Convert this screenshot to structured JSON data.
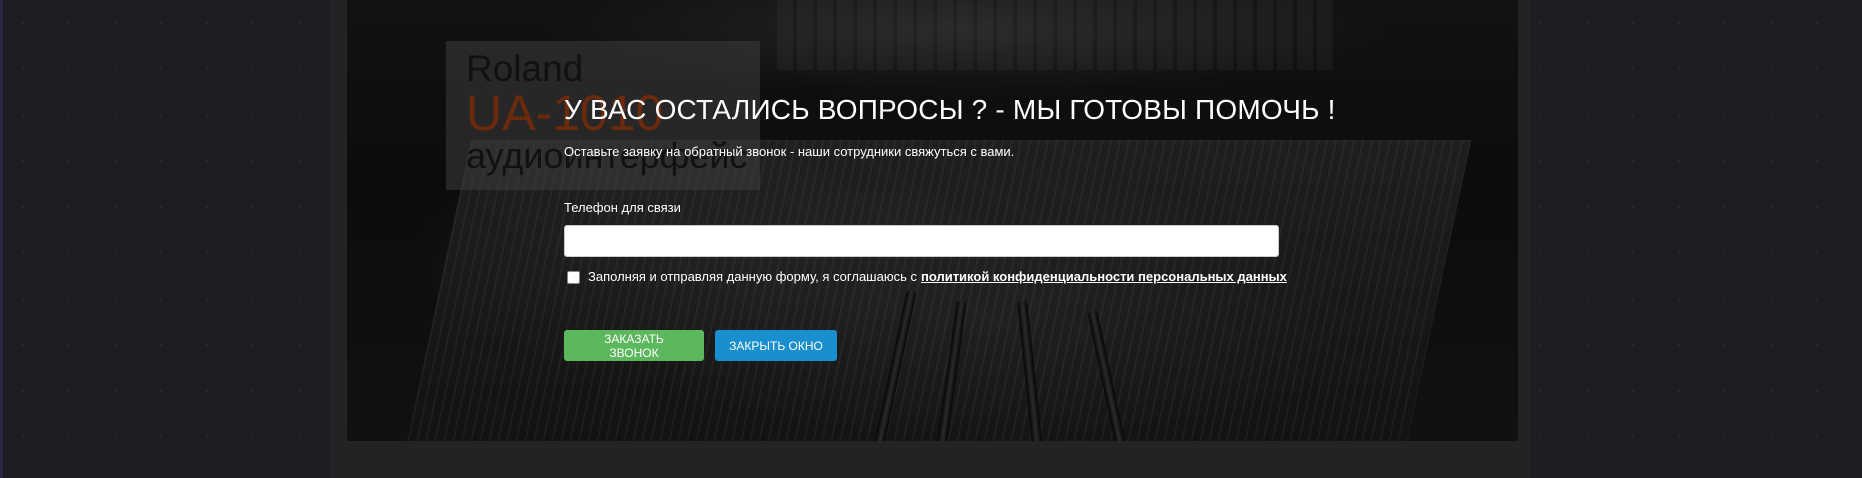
{
  "promo": {
    "brand": "Roland",
    "model": "UA-1010",
    "type": "аудиоинтерфейс"
  },
  "callback_form": {
    "title": "У ВАС ОСТАЛИСЬ ВОПРОСЫ ? - МЫ ГОТОВЫ ПОМОЧЬ !",
    "subtitle": "Оставьте заявку на обратный звонок - наши сотрудники свяжуться с вами.",
    "phone_label": "Телефон для связи",
    "phone_value": "",
    "phone_placeholder": "",
    "consent_checked": false,
    "consent_text": "Заполняя и отправляя данную форму, я соглашаюсь с",
    "consent_link_text": "политикой конфиденциальности персональных данных",
    "order_button_label": "ЗАКАЗАТЬ ЗВОНОК",
    "close_button_label": "ЗАКРЫТЬ ОКНО"
  },
  "colors": {
    "order_button": "#5cb85c",
    "close_button": "#1a8fcf",
    "text": "#ffffff",
    "promo_model": "#6b2a0c"
  }
}
